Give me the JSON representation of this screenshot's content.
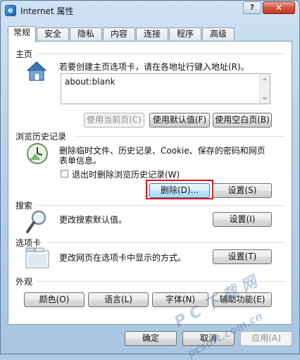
{
  "window": {
    "title": "Internet 属性",
    "help_glyph": "?",
    "close_glyph": "✕"
  },
  "tabs": [
    "常规",
    "安全",
    "隐私",
    "内容",
    "连接",
    "程序",
    "高级"
  ],
  "home": {
    "section": "主页",
    "description": "若要创建主页选项卡，请在各地址行键入地址(R)。",
    "address": "about:blank",
    "buttons": {
      "use_current": "使用当前页(C)",
      "use_default": "使用默认值(F)",
      "use_blank": "使用空白页(B)"
    }
  },
  "history": {
    "section": "浏览历史记录",
    "description_line1": "删除临时文件、历史记录、Cookie、保存的密码和网页",
    "description_line2": "表单信息。",
    "checkbox_label": "退出时删除浏览历史记录(W)",
    "delete_button": "删除(D)...",
    "settings_button": "设置(S)"
  },
  "search": {
    "section": "搜索",
    "description": "更改搜索默认值。",
    "settings_button": "设置(I)"
  },
  "tabs_section": {
    "section": "选项卡",
    "description": "更改网页在选项卡中显示的方式。",
    "settings_button": "设置(T)"
  },
  "appearance": {
    "section": "外观",
    "colors": "颜色(O)",
    "languages": "语言(L)",
    "fonts": "字体(N)",
    "accessibility": "辅助功能(E)"
  },
  "footer": {
    "ok": "确定",
    "cancel": "取消",
    "apply": "应用(A)"
  },
  "watermark": {
    "line1": "P C 下 载 网",
    "line2": "pcsoft.com.cn"
  },
  "colors": {
    "highlight": "#e0141c",
    "accent": "#3c7fb1"
  }
}
